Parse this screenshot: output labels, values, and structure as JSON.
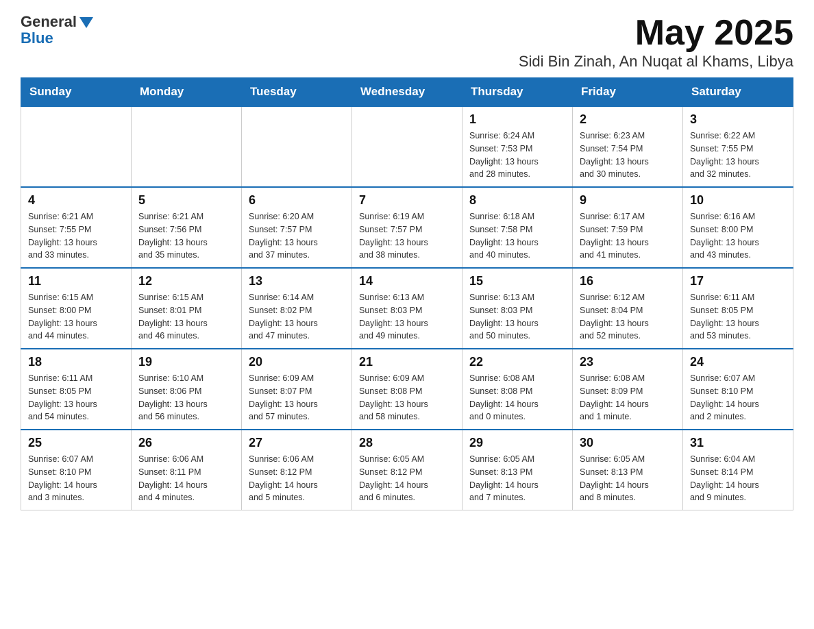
{
  "header": {
    "logo_general": "General",
    "logo_blue": "Blue",
    "title": "May 2025",
    "subtitle": "Sidi Bin Zinah, An Nuqat al Khams, Libya"
  },
  "days_of_week": [
    "Sunday",
    "Monday",
    "Tuesday",
    "Wednesday",
    "Thursday",
    "Friday",
    "Saturday"
  ],
  "weeks": [
    {
      "days": [
        {
          "num": "",
          "info": ""
        },
        {
          "num": "",
          "info": ""
        },
        {
          "num": "",
          "info": ""
        },
        {
          "num": "",
          "info": ""
        },
        {
          "num": "1",
          "info": "Sunrise: 6:24 AM\nSunset: 7:53 PM\nDaylight: 13 hours\nand 28 minutes."
        },
        {
          "num": "2",
          "info": "Sunrise: 6:23 AM\nSunset: 7:54 PM\nDaylight: 13 hours\nand 30 minutes."
        },
        {
          "num": "3",
          "info": "Sunrise: 6:22 AM\nSunset: 7:55 PM\nDaylight: 13 hours\nand 32 minutes."
        }
      ]
    },
    {
      "days": [
        {
          "num": "4",
          "info": "Sunrise: 6:21 AM\nSunset: 7:55 PM\nDaylight: 13 hours\nand 33 minutes."
        },
        {
          "num": "5",
          "info": "Sunrise: 6:21 AM\nSunset: 7:56 PM\nDaylight: 13 hours\nand 35 minutes."
        },
        {
          "num": "6",
          "info": "Sunrise: 6:20 AM\nSunset: 7:57 PM\nDaylight: 13 hours\nand 37 minutes."
        },
        {
          "num": "7",
          "info": "Sunrise: 6:19 AM\nSunset: 7:57 PM\nDaylight: 13 hours\nand 38 minutes."
        },
        {
          "num": "8",
          "info": "Sunrise: 6:18 AM\nSunset: 7:58 PM\nDaylight: 13 hours\nand 40 minutes."
        },
        {
          "num": "9",
          "info": "Sunrise: 6:17 AM\nSunset: 7:59 PM\nDaylight: 13 hours\nand 41 minutes."
        },
        {
          "num": "10",
          "info": "Sunrise: 6:16 AM\nSunset: 8:00 PM\nDaylight: 13 hours\nand 43 minutes."
        }
      ]
    },
    {
      "days": [
        {
          "num": "11",
          "info": "Sunrise: 6:15 AM\nSunset: 8:00 PM\nDaylight: 13 hours\nand 44 minutes."
        },
        {
          "num": "12",
          "info": "Sunrise: 6:15 AM\nSunset: 8:01 PM\nDaylight: 13 hours\nand 46 minutes."
        },
        {
          "num": "13",
          "info": "Sunrise: 6:14 AM\nSunset: 8:02 PM\nDaylight: 13 hours\nand 47 minutes."
        },
        {
          "num": "14",
          "info": "Sunrise: 6:13 AM\nSunset: 8:03 PM\nDaylight: 13 hours\nand 49 minutes."
        },
        {
          "num": "15",
          "info": "Sunrise: 6:13 AM\nSunset: 8:03 PM\nDaylight: 13 hours\nand 50 minutes."
        },
        {
          "num": "16",
          "info": "Sunrise: 6:12 AM\nSunset: 8:04 PM\nDaylight: 13 hours\nand 52 minutes."
        },
        {
          "num": "17",
          "info": "Sunrise: 6:11 AM\nSunset: 8:05 PM\nDaylight: 13 hours\nand 53 minutes."
        }
      ]
    },
    {
      "days": [
        {
          "num": "18",
          "info": "Sunrise: 6:11 AM\nSunset: 8:05 PM\nDaylight: 13 hours\nand 54 minutes."
        },
        {
          "num": "19",
          "info": "Sunrise: 6:10 AM\nSunset: 8:06 PM\nDaylight: 13 hours\nand 56 minutes."
        },
        {
          "num": "20",
          "info": "Sunrise: 6:09 AM\nSunset: 8:07 PM\nDaylight: 13 hours\nand 57 minutes."
        },
        {
          "num": "21",
          "info": "Sunrise: 6:09 AM\nSunset: 8:08 PM\nDaylight: 13 hours\nand 58 minutes."
        },
        {
          "num": "22",
          "info": "Sunrise: 6:08 AM\nSunset: 8:08 PM\nDaylight: 14 hours\nand 0 minutes."
        },
        {
          "num": "23",
          "info": "Sunrise: 6:08 AM\nSunset: 8:09 PM\nDaylight: 14 hours\nand 1 minute."
        },
        {
          "num": "24",
          "info": "Sunrise: 6:07 AM\nSunset: 8:10 PM\nDaylight: 14 hours\nand 2 minutes."
        }
      ]
    },
    {
      "days": [
        {
          "num": "25",
          "info": "Sunrise: 6:07 AM\nSunset: 8:10 PM\nDaylight: 14 hours\nand 3 minutes."
        },
        {
          "num": "26",
          "info": "Sunrise: 6:06 AM\nSunset: 8:11 PM\nDaylight: 14 hours\nand 4 minutes."
        },
        {
          "num": "27",
          "info": "Sunrise: 6:06 AM\nSunset: 8:12 PM\nDaylight: 14 hours\nand 5 minutes."
        },
        {
          "num": "28",
          "info": "Sunrise: 6:05 AM\nSunset: 8:12 PM\nDaylight: 14 hours\nand 6 minutes."
        },
        {
          "num": "29",
          "info": "Sunrise: 6:05 AM\nSunset: 8:13 PM\nDaylight: 14 hours\nand 7 minutes."
        },
        {
          "num": "30",
          "info": "Sunrise: 6:05 AM\nSunset: 8:13 PM\nDaylight: 14 hours\nand 8 minutes."
        },
        {
          "num": "31",
          "info": "Sunrise: 6:04 AM\nSunset: 8:14 PM\nDaylight: 14 hours\nand 9 minutes."
        }
      ]
    }
  ]
}
